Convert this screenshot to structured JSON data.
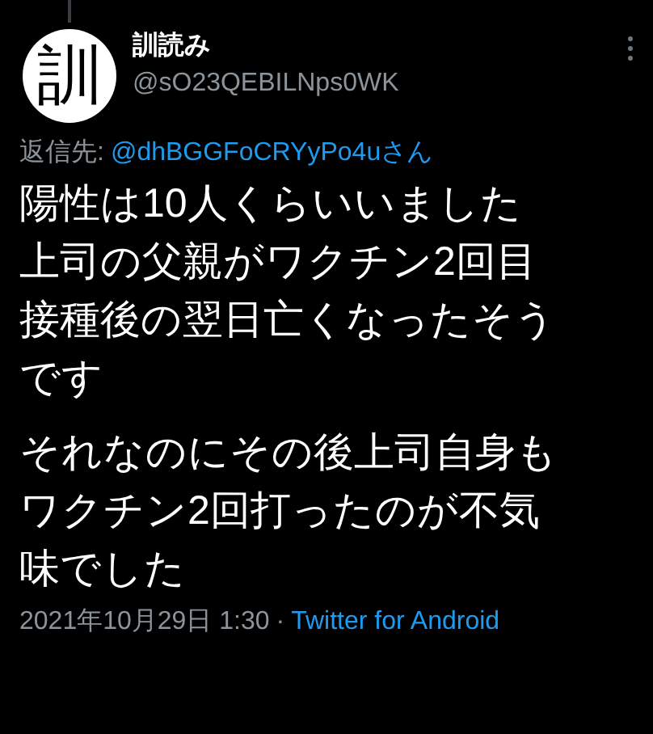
{
  "tweet": {
    "avatar_text": "訓",
    "name": "訓読み",
    "handle": "@sO23QEBILNps0WK",
    "reply_label": "返信先:",
    "reply_to": "@dhBGGFoCRYyPo4uさん",
    "paragraphs": [
      [
        "陽性は10人くらいいました",
        "上司の父親がワクチン2回目",
        "接種後の翌日亡くなったそう",
        "です"
      ],
      [
        "それなのにその後上司自身も",
        "ワクチン2回打ったのが不気",
        "味でした"
      ]
    ],
    "timestamp": "2021年10月29日 1:30",
    "separator": "·",
    "source": "Twitter for Android"
  }
}
